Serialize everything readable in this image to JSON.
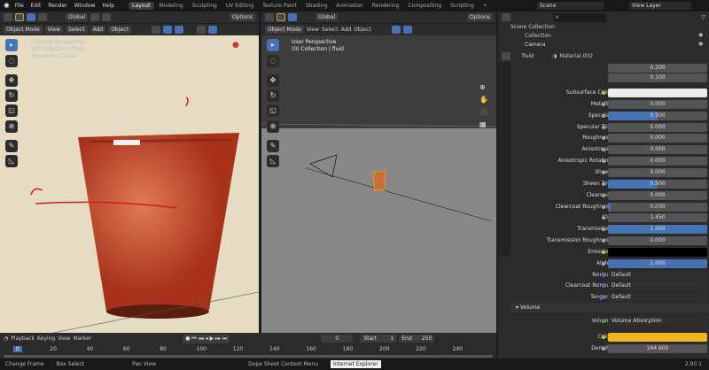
{
  "topbar": {
    "menus": [
      "File",
      "Edit",
      "Render",
      "Window",
      "Help"
    ],
    "workspaces": [
      "Layout",
      "Modeling",
      "Sculpting",
      "UV Editing",
      "Texture Paint",
      "Shading",
      "Animation",
      "Rendering",
      "Compositing",
      "Scripting"
    ],
    "active": "Layout",
    "add": "+",
    "scene": "Scene",
    "view_layer": "View Layer"
  },
  "viewport_left": {
    "transform": "Global",
    "options": "Options",
    "mode": "Object Mode",
    "menus": [
      "View",
      "Select",
      "Add",
      "Object"
    ],
    "info": [
      "Camera Perspective",
      "(0) Collection | fluid",
      "Rendering Done"
    ]
  },
  "viewport_right": {
    "transform": "Global",
    "options": "Options",
    "mode": "Object Mode",
    "menus": [
      "View",
      "Select",
      "Add",
      "Object"
    ],
    "info": [
      "User Perspective",
      "(0) Collection | fluid"
    ]
  },
  "outliner": {
    "items": [
      "Scene Collection",
      "Collection",
      "Camera"
    ]
  },
  "properties": {
    "object": "fluid",
    "material": "Material.002",
    "top_values": [
      "0.200",
      "0.100"
    ],
    "rows": [
      {
        "label": "Subsurface Color",
        "type": "color",
        "color": "#ececec"
      },
      {
        "label": "Metallic",
        "value": "0.000",
        "fill": 0
      },
      {
        "label": "Specular",
        "value": "0.500",
        "fill": 0.5
      },
      {
        "label": "Specular Tint",
        "value": "0.000",
        "fill": 0
      },
      {
        "label": "Roughness",
        "value": "0.000",
        "fill": 0
      },
      {
        "label": "Anisotropic",
        "value": "0.000",
        "fill": 0
      },
      {
        "label": "Anisotropic Rotation",
        "value": "0.000",
        "fill": 0
      },
      {
        "label": "Sheen",
        "value": "0.000",
        "fill": 0
      },
      {
        "label": "Sheen Tint",
        "value": "0.500",
        "fill": 0.5
      },
      {
        "label": "Clearcoat",
        "value": "0.000",
        "fill": 0
      },
      {
        "label": "Clearcoat Roughness",
        "value": "0.030",
        "fill": 0.03
      },
      {
        "label": "IOR",
        "value": "1.450",
        "fill": 0
      },
      {
        "label": "Transmission",
        "value": "1.000",
        "fill": 1
      },
      {
        "label": "Transmission Roughness",
        "value": "0.000",
        "fill": 0
      },
      {
        "label": "Emission",
        "type": "color",
        "color": "#000000"
      },
      {
        "label": "Alpha",
        "value": "1.000",
        "fill": 1
      },
      {
        "label": "Normal",
        "type": "link",
        "value": "Default"
      },
      {
        "label": "Clearcoat Normal",
        "type": "link",
        "value": "Default"
      },
      {
        "label": "Tangent",
        "type": "link",
        "value": "Default"
      }
    ],
    "volume": {
      "section": "Volume",
      "volume_label": "Volume",
      "volume_value": "Volume Absorption",
      "color_label": "Color",
      "color": "#f0b51f",
      "density_label": "Density",
      "density_value": "164.600"
    },
    "version": "2.90.1"
  },
  "timeline": {
    "menus": [
      "Playback",
      "Keying",
      "View",
      "Marker"
    ],
    "current_frame": "0",
    "start_label": "Start",
    "start": "1",
    "end_label": "End",
    "end": "250",
    "ticks": [
      "0",
      "20",
      "40",
      "60",
      "80",
      "100",
      "120",
      "140",
      "160",
      "180",
      "200",
      "220",
      "240"
    ]
  },
  "status": {
    "items": [
      "Change Frame",
      "Box Select",
      "Pan View",
      "Dope Sheet Context Menu"
    ],
    "tooltip": "Internet Explorer"
  }
}
